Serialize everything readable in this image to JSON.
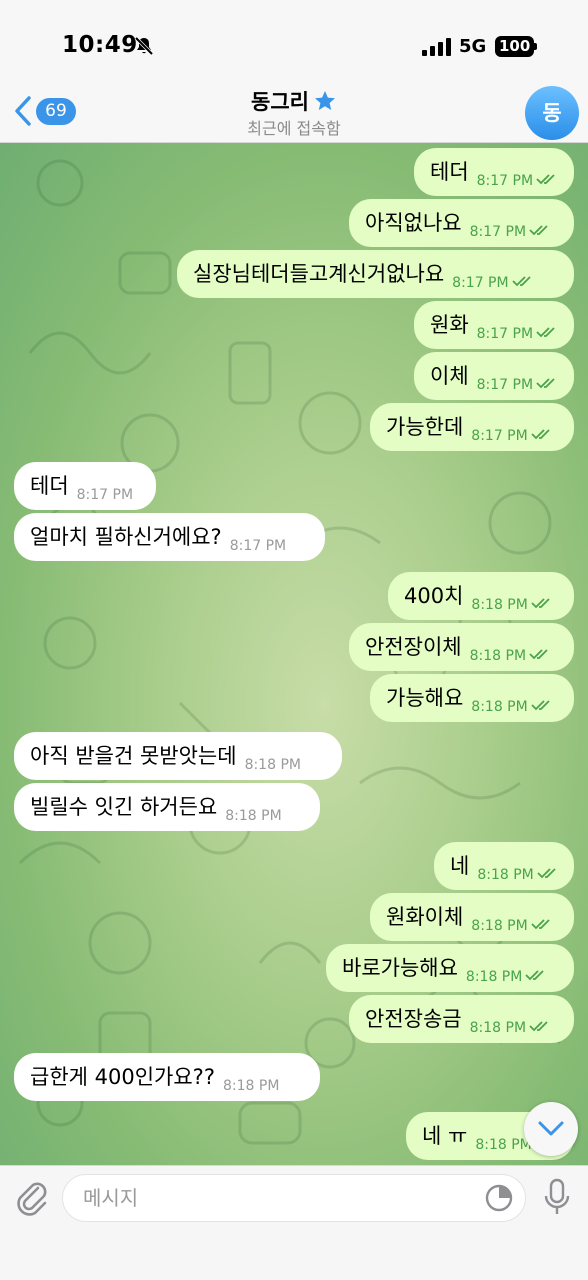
{
  "status_bar": {
    "time": "10:49",
    "network": "5G",
    "battery": "100"
  },
  "header": {
    "back_count": "69",
    "title": "동그리",
    "subtitle": "최근에 접속함",
    "avatar_initial": "동"
  },
  "messages": [
    {
      "dir": "out",
      "text": "테더",
      "time": "8:17 PM",
      "read": true
    },
    {
      "dir": "out",
      "text": "아직없나요",
      "time": "8:17 PM",
      "read": true
    },
    {
      "dir": "out",
      "text": "실장님테더들고계신거없나요",
      "time": "8:17 PM",
      "read": true
    },
    {
      "dir": "out",
      "text": "원화",
      "time": "8:17 PM",
      "read": true
    },
    {
      "dir": "out",
      "text": "이체",
      "time": "8:17 PM",
      "read": true
    },
    {
      "dir": "out",
      "text": "가능한데",
      "time": "8:17 PM",
      "read": true
    },
    {
      "dir": "in",
      "text": "테더",
      "time": "8:17 PM"
    },
    {
      "dir": "in",
      "text": "얼마치 필하신거에요?",
      "time": "8:17 PM"
    },
    {
      "dir": "out",
      "text": "400치",
      "time": "8:18 PM",
      "read": true
    },
    {
      "dir": "out",
      "text": "안전장이체",
      "time": "8:18 PM",
      "read": true
    },
    {
      "dir": "out",
      "text": "가능해요",
      "time": "8:18 PM",
      "read": true
    },
    {
      "dir": "in",
      "text": "아직 받을건 못받앗는데",
      "time": "8:18 PM"
    },
    {
      "dir": "in",
      "text": "빌릴수 잇긴 하거든요",
      "time": "8:18 PM"
    },
    {
      "dir": "out",
      "text": "네",
      "time": "8:18 PM",
      "read": true
    },
    {
      "dir": "out",
      "text": "원화이체",
      "time": "8:18 PM",
      "read": true
    },
    {
      "dir": "out",
      "text": "바로가능해요",
      "time": "8:18 PM",
      "read": true
    },
    {
      "dir": "out",
      "text": "안전장송금",
      "time": "8:18 PM",
      "read": true
    },
    {
      "dir": "in",
      "text": "급한게 400인가요??",
      "time": "8:18 PM"
    },
    {
      "dir": "out",
      "text": "네 ㅠ",
      "time": "8:18 PM",
      "read": true
    }
  ],
  "composer": {
    "placeholder": "메시지"
  },
  "colors": {
    "accent": "#3a95e8",
    "outgoing": "#e3fdc4",
    "incoming": "#ffffff",
    "check": "#4aa34a"
  }
}
